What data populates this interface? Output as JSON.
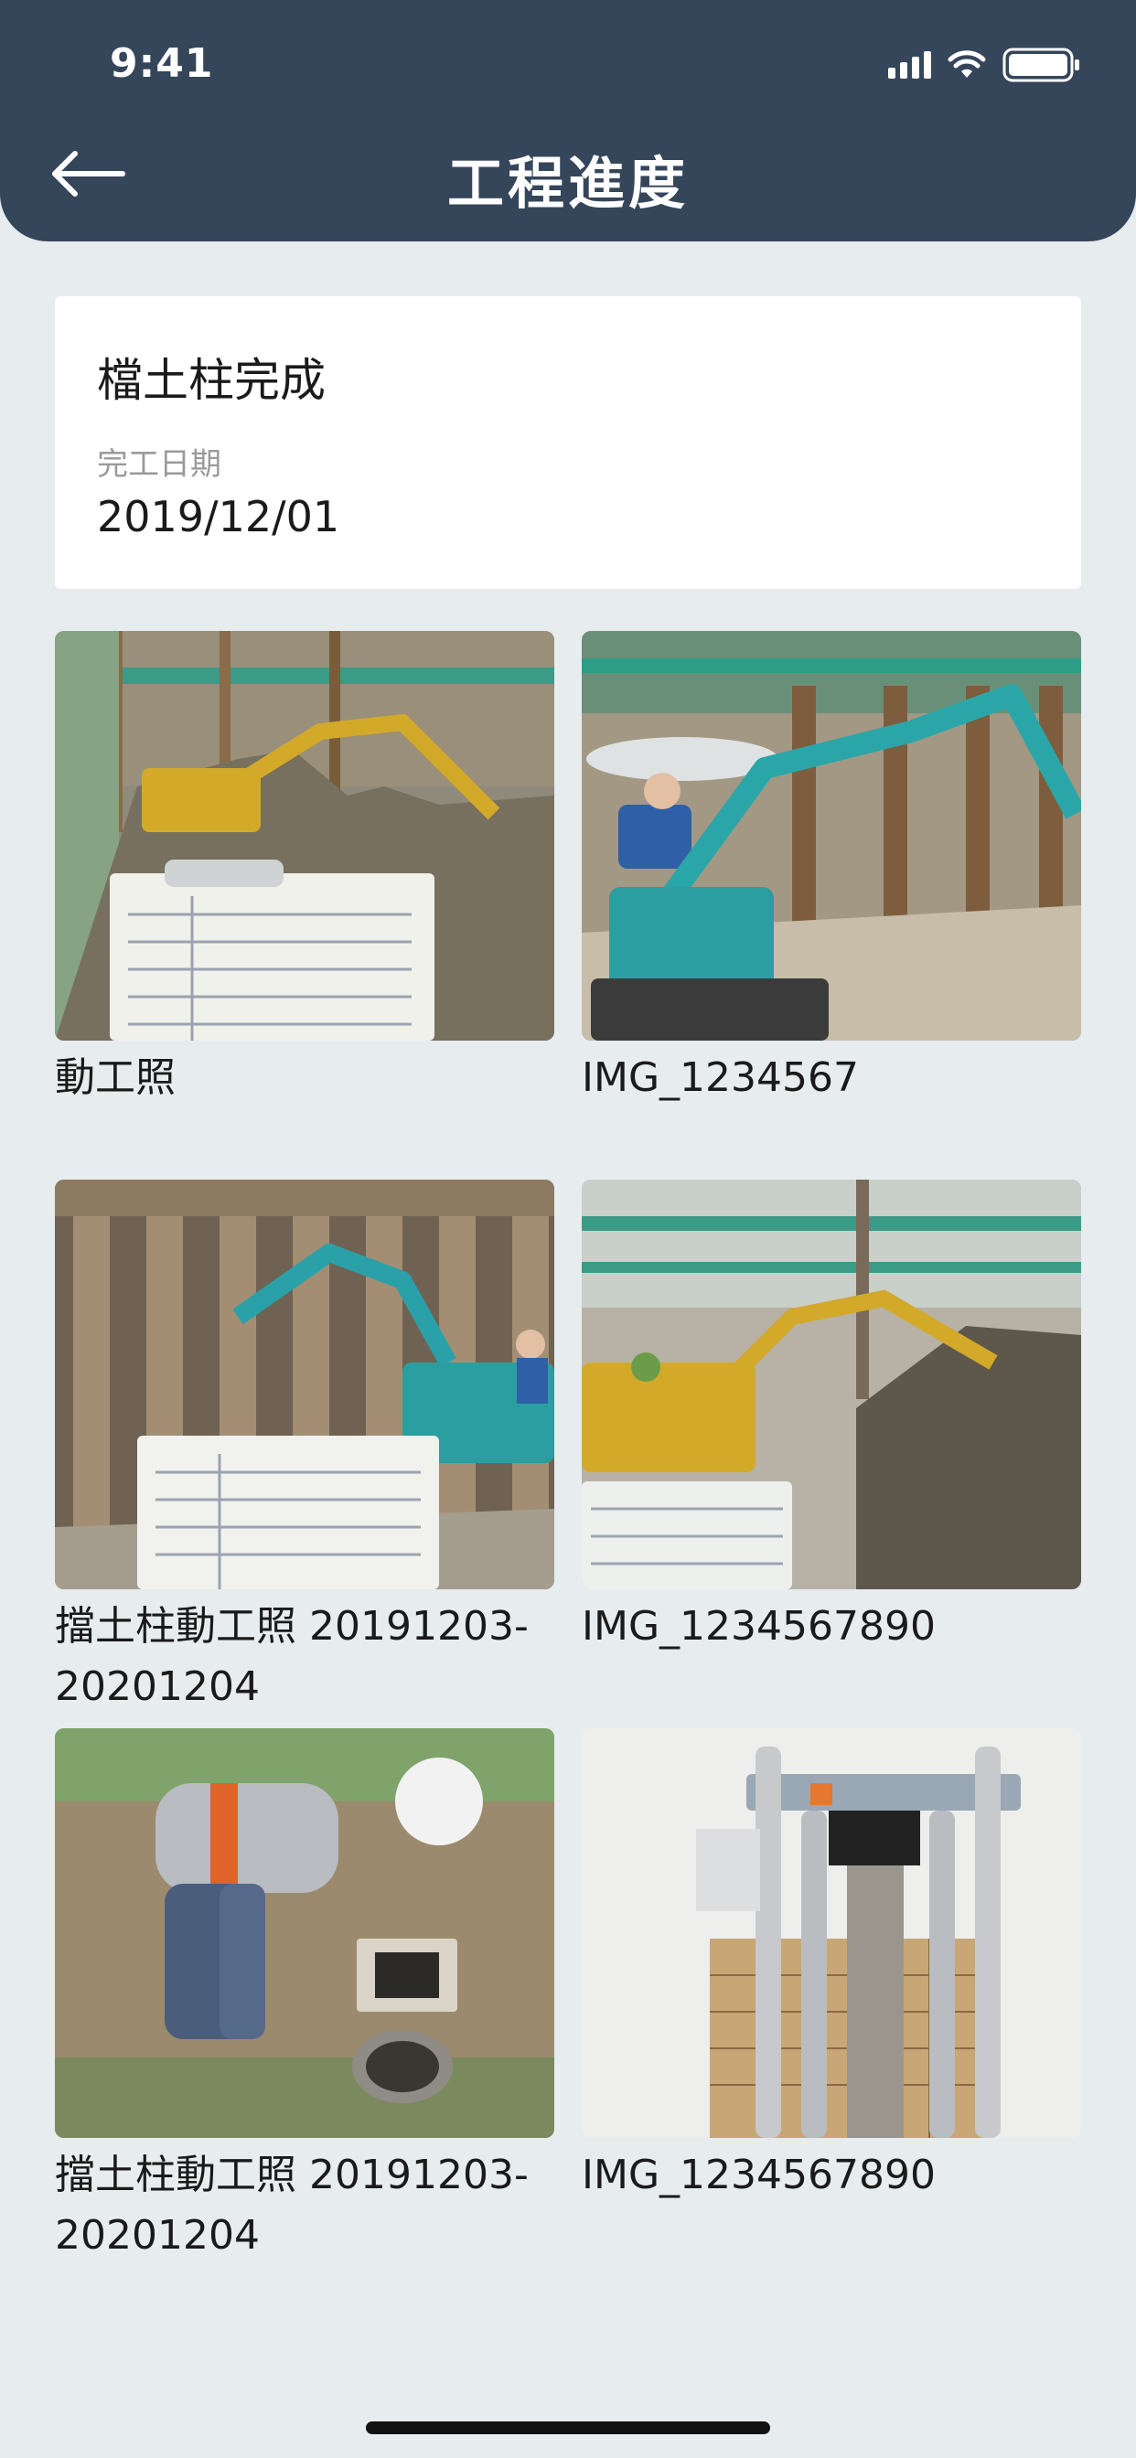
{
  "status_bar": {
    "time": "9:41"
  },
  "header": {
    "title": "工程進度",
    "back_icon": "arrow-left-icon"
  },
  "milestone": {
    "title": "檔土柱完成",
    "date_label": "完工日期",
    "date_value": "2019/12/01"
  },
  "photos": [
    {
      "caption": "動工照"
    },
    {
      "caption": "IMG_1234567"
    },
    {
      "caption": "擋土柱動工照 20191203-20201204"
    },
    {
      "caption": "IMG_1234567890"
    },
    {
      "caption": "擋土柱動工照 20191203-20201204"
    },
    {
      "caption": "IMG_1234567890"
    }
  ],
  "colors": {
    "header_bg": "#35465a",
    "page_bg": "#e7ecef",
    "card_bg": "#ffffff"
  }
}
